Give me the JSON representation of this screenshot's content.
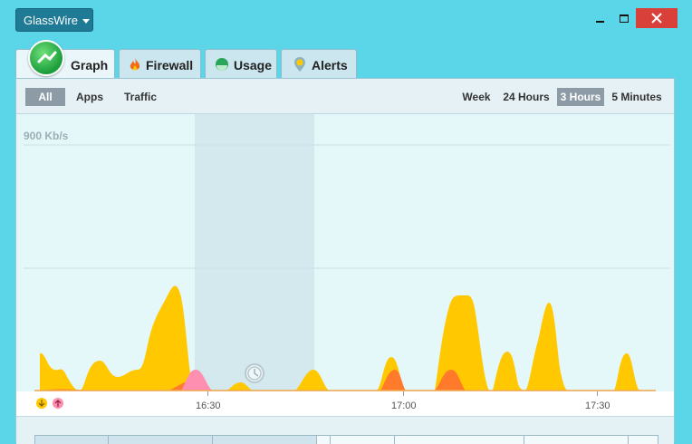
{
  "app": {
    "menu_label": "GlassWire"
  },
  "tabs": [
    {
      "label": "Graph",
      "icon": "graph-icon"
    },
    {
      "label": "Firewall",
      "icon": "flame-icon"
    },
    {
      "label": "Usage",
      "icon": "usage-icon"
    },
    {
      "label": "Alerts",
      "icon": "alert-pin-icon"
    }
  ],
  "filters": {
    "all": "All",
    "apps": "Apps",
    "traffic": "Traffic",
    "selected": "All"
  },
  "ranges": {
    "week": "Week",
    "h24": "24 Hours",
    "h3": "3 Hours",
    "m5": "5 Minutes",
    "selected": "3 Hours"
  },
  "graph": {
    "scale_label": "900 Kb/s",
    "time_labels": [
      "16:30",
      "17:00",
      "17:30"
    ],
    "colors": {
      "incoming": "#ffc800",
      "outgoing": "#ff7a2a",
      "outgoing_pink": "#ff8fb1",
      "background": "#e4f7f9"
    }
  }
}
